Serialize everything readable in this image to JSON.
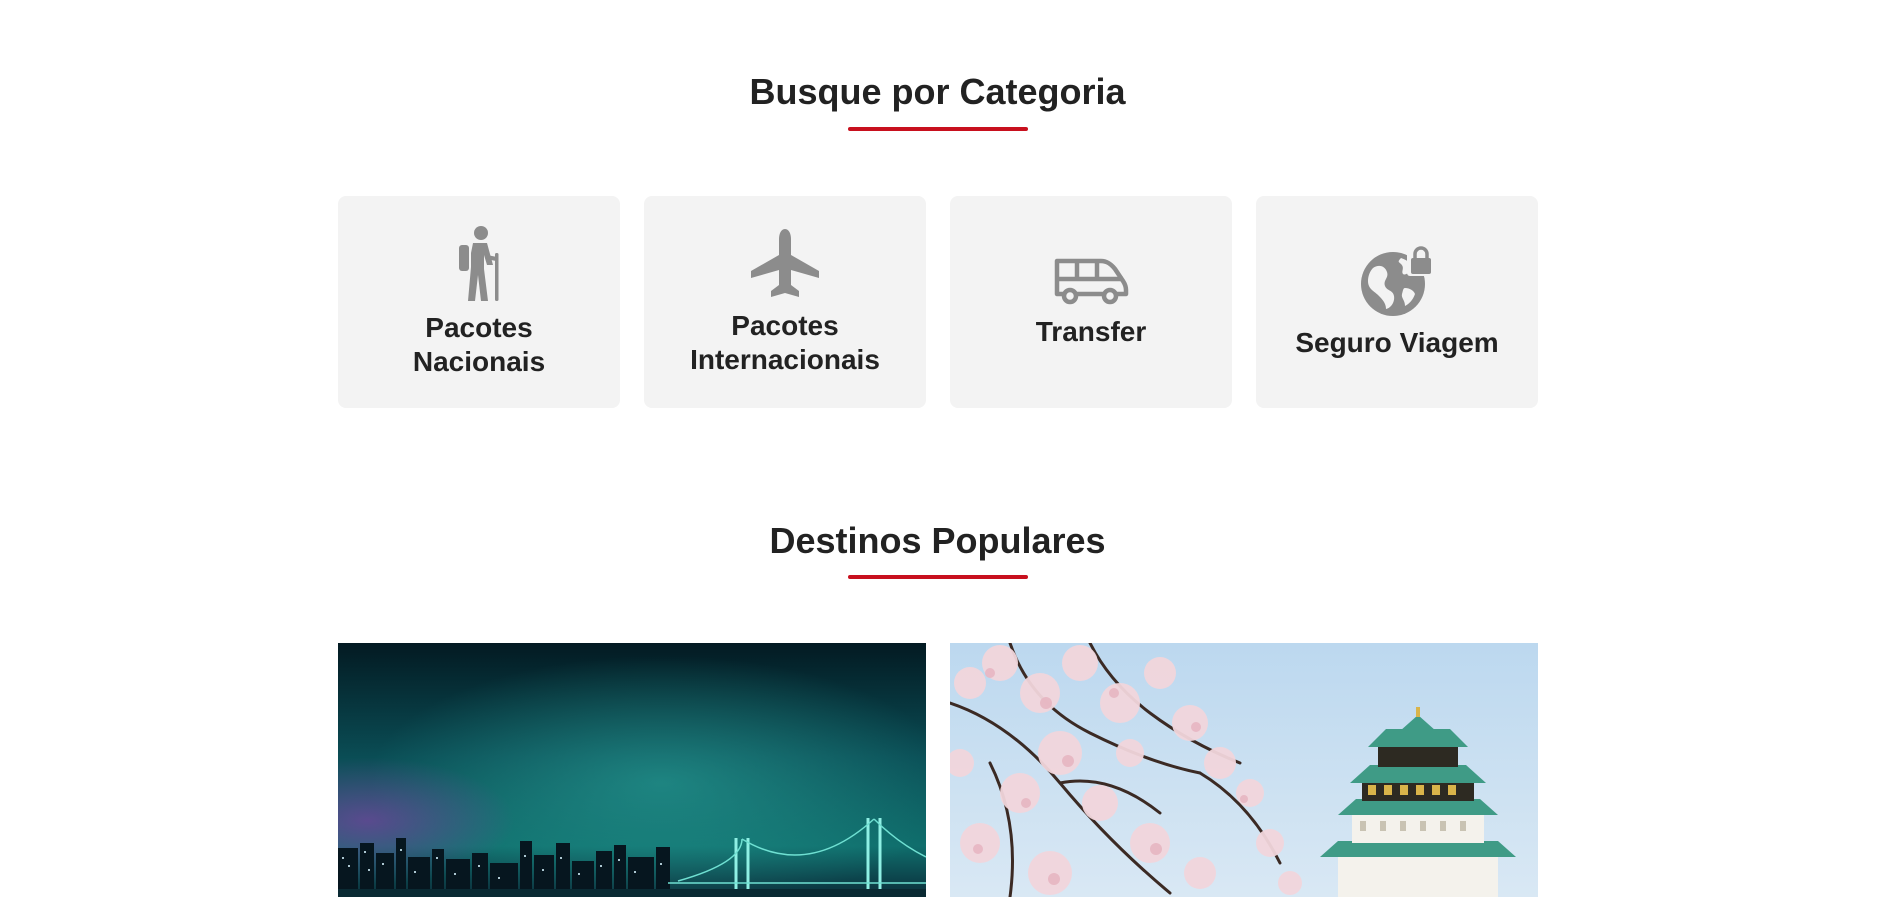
{
  "categories_section": {
    "title": "Busque por Categoria",
    "items": [
      {
        "label": "Pacotes\nNacionais",
        "icon": "hiker-icon"
      },
      {
        "label": "Pacotes\nInternacionais",
        "icon": "airplane-icon"
      },
      {
        "label": "Transfer",
        "icon": "van-icon"
      },
      {
        "label": "Seguro Viagem",
        "icon": "globe-lock-icon"
      }
    ]
  },
  "destinations_section": {
    "title": "Destinos Populares",
    "cards": [
      {
        "image": "tokyo-night-bridge-image"
      },
      {
        "image": "osaka-castle-sakura-image"
      }
    ]
  },
  "colors": {
    "accent": "#c8101e",
    "card_bg": "#f3f3f3",
    "icon": "#8c8c8c",
    "heading": "#222222"
  }
}
